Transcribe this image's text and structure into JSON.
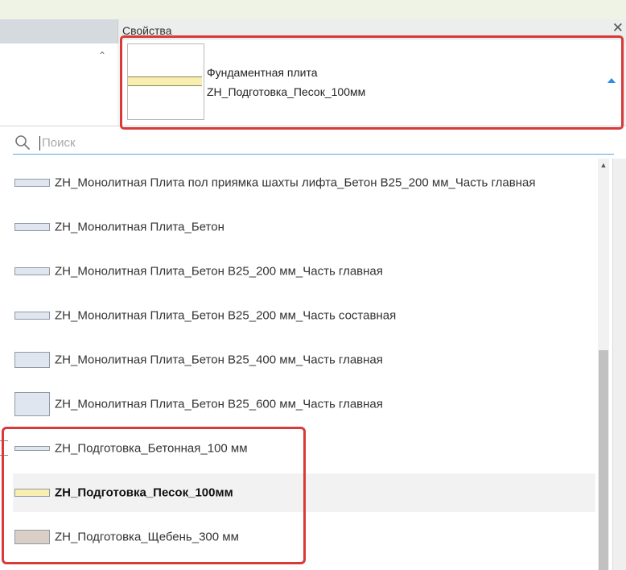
{
  "header": {
    "panel_title": "Свойства",
    "close_glyph": "✕"
  },
  "left_pane": {
    "scroll_up_glyph": "⌃"
  },
  "type_selector": {
    "family": "Фундаментная плита",
    "type": "ZH_Подготовка_Песок_100мм",
    "swatch_color": "#f7eeb0"
  },
  "search": {
    "placeholder": "Поиск",
    "value": ""
  },
  "list": {
    "scroll_up_glyph": "▲",
    "items": [
      {
        "label": "ZH_Монолитная Плита пол приямка шахты лифта_Бетон B25_200 мм_Часть главная",
        "swatch_color": "#dfe6ef"
      },
      {
        "label": "ZH_Монолитная Плита_Бетон",
        "swatch_color": "#dfe6ef"
      },
      {
        "label": "ZH_Монолитная Плита_Бетон B25_200 мм_Часть главная",
        "swatch_color": "#dfe6ef"
      },
      {
        "label": "ZH_Монолитная Плита_Бетон B25_200 мм_Часть составная",
        "swatch_color": "#dfe6ef"
      },
      {
        "label": "ZH_Монолитная Плита_Бетон B25_400 мм_Часть главная",
        "swatch_color": "#dfe6ef"
      },
      {
        "label": "ZH_Монолитная Плита_Бетон B25_600 мм_Часть главная",
        "swatch_color": "#dfe6ef"
      },
      {
        "label": "ZH_Подготовка_Бетонная_100 мм",
        "swatch_color": "#dfe6ef"
      },
      {
        "label": "ZH_Подготовка_Песок_100мм",
        "swatch_color": "#f7eeb0",
        "selected": true
      },
      {
        "label": "ZH_Подготовка_Щебень_300 мм",
        "swatch_color": "#d9cfc6"
      }
    ]
  },
  "colors": {
    "highlight": "#d83a3a",
    "accent": "#2b8be8"
  }
}
